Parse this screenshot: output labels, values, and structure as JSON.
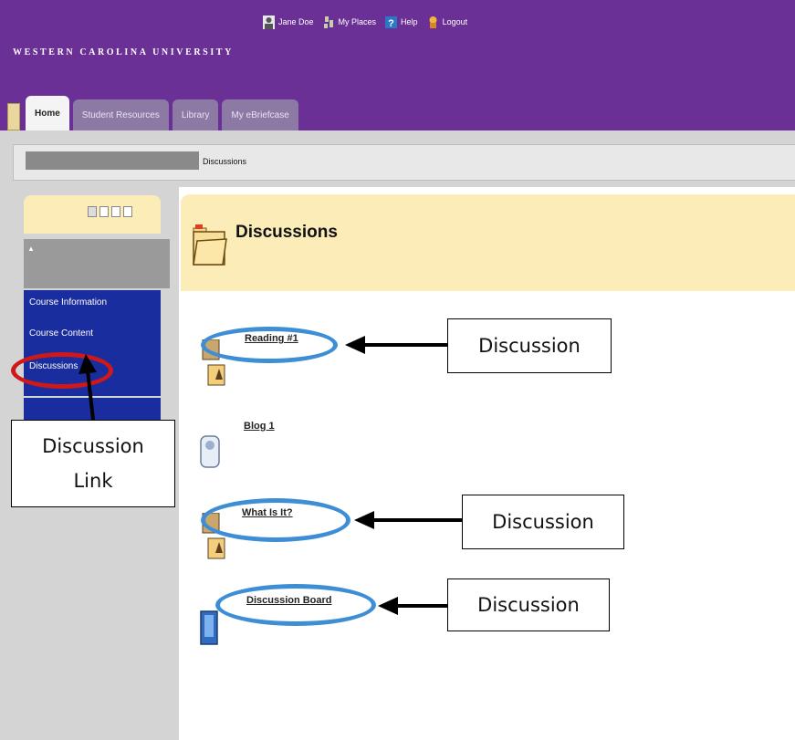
{
  "header": {
    "university_name": "WESTERN CAROLINA UNIVERSITY",
    "user_name": "Jane Doe",
    "links": [
      "My Places",
      "Help",
      "Logout"
    ],
    "bg_color": "#6a3096"
  },
  "tabs": [
    {
      "label": "Home",
      "active": true
    },
    {
      "label": "Student Resources",
      "active": false
    },
    {
      "label": "Library",
      "active": false
    },
    {
      "label": "My eBriefcase",
      "active": false
    }
  ],
  "breadcrumb": {
    "current": "Discussions"
  },
  "nav": {
    "items": [
      "Course Information",
      "Course Content",
      "Discussions"
    ],
    "menu_color": "#1a2d9e"
  },
  "content": {
    "title": "Discussions",
    "items": [
      {
        "label": "Reading #1",
        "icon": "discussion-topic-icon"
      },
      {
        "label": "Blog 1",
        "icon": "blog-icon"
      },
      {
        "label": "What Is It?",
        "icon": "discussion-topic-icon"
      },
      {
        "label": "Discussion Board",
        "icon": "discussion-board-icon"
      }
    ]
  },
  "annotations": {
    "callout_label": "Discussion",
    "nav_callout_line1": "Discussion",
    "nav_callout_line2": "Link",
    "highlight_color": "#3e8ed6",
    "nav_highlight_color": "#d01818"
  }
}
